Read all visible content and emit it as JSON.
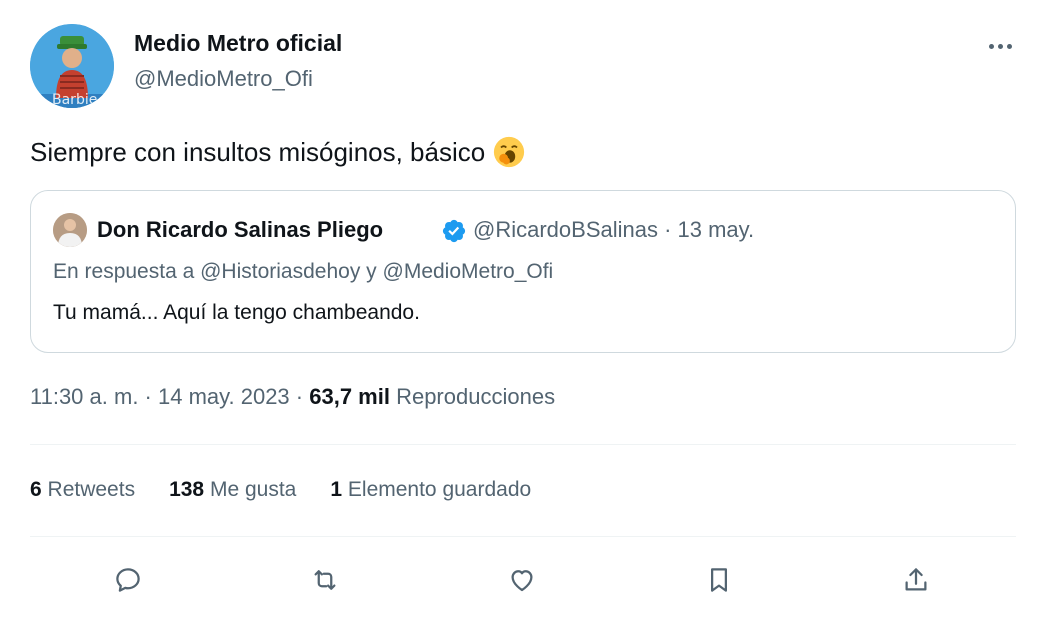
{
  "author": {
    "display_name": "Medio Metro oficial",
    "handle": "@MedioMetro_Ofi",
    "avatar_icon": "profile-avatar",
    "avatar_overlay_text": "Barbie"
  },
  "tweet": {
    "text": "Siempre con insultos misóginos, básico",
    "emoji": "yawning-face-emoji"
  },
  "quote": {
    "display_name": "Don Ricardo Salinas Pliego",
    "verified_icon": "verified-badge-icon",
    "meta": "@RicardoBSalinas · 13 may.",
    "reply_prefix": "En respuesta a",
    "reply_mention_1": "@Historiasdehoy",
    "reply_joiner": "y",
    "reply_mention_2": "@MedioMetro_Ofi",
    "body": "Tu mamá... Aquí la tengo chambeando."
  },
  "meta": {
    "time_date": "11:30 a. m. · 14 may. 2023 ·",
    "views_count": "63,7 mil",
    "views_label": "Reproducciones"
  },
  "stats": {
    "retweets_count": "6",
    "retweets_label": "Retweets",
    "likes_count": "138",
    "likes_label": "Me gusta",
    "bookmarks_count": "1",
    "bookmarks_label": "Elemento guardado"
  },
  "actions": [
    {
      "name": "reply-icon"
    },
    {
      "name": "retweet-icon"
    },
    {
      "name": "like-icon"
    },
    {
      "name": "bookmark-icon"
    },
    {
      "name": "share-icon"
    }
  ],
  "colors": {
    "text_primary": "#0f1419",
    "text_secondary": "#536471",
    "border": "#cfd9de",
    "divider": "#eff3f4",
    "verified": "#1d9bf0"
  }
}
